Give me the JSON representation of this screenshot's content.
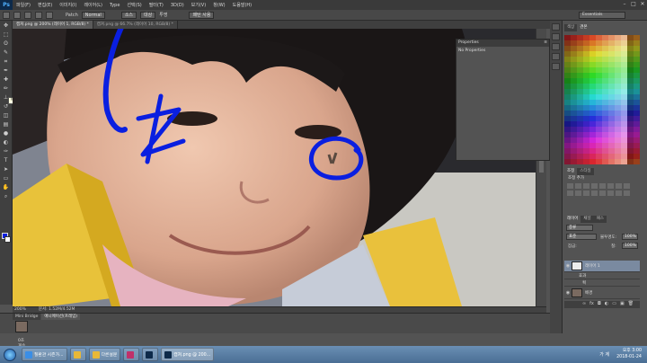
{
  "menubar": {
    "logo": "Ps",
    "items": [
      "파일(F)",
      "편집(E)",
      "이미지(I)",
      "레이어(L)",
      "Type",
      "선택(S)",
      "필터(T)",
      "3D(D)",
      "보기(V)",
      "창(W)",
      "도움말(H)"
    ]
  },
  "options": {
    "patch_label": "Patch",
    "mode_value": "Normal",
    "source_label": "소스",
    "dest_label": "대상",
    "transparent_label": "투명",
    "use_pattern_label": "패턴 사용"
  },
  "workspace": {
    "value": "Essentials"
  },
  "doc_tabs": [
    {
      "label": "캡쳐.png @ 200% (레이어 1, RGB/8) *"
    },
    {
      "label": "캡쳐.png @ 66.7% (레이어 10, RGB/8) *"
    }
  ],
  "tooltip": {
    "text": "패치 도구 (J)"
  },
  "status": {
    "zoom": "200%",
    "doc": "문서: 1.52M/4.52M"
  },
  "properties": {
    "title": "Properties",
    "body": "No Properties"
  },
  "panels": {
    "color_tabs": [
      "색상",
      "견본"
    ],
    "adjust_tabs": [
      "조정",
      "스타일"
    ],
    "adjust_title": "조정 추가",
    "layer_tabs": [
      "레이어",
      "채널",
      "패스"
    ],
    "kind_label": "종류",
    "blend_value": "표준",
    "opacity_label": "불투명도:",
    "opacity_value": "100%",
    "lock_label": "잠금:",
    "fill_label": "칠:",
    "fill_value": "100%",
    "layers": [
      {
        "name": "레이어 1",
        "selected": true
      },
      {
        "name": "효과"
      },
      {
        "name": "획"
      },
      {
        "name": "배경"
      }
    ]
  },
  "lower": {
    "tabs": [
      "Mini Bridge",
      "애니메이션(프레임)"
    ],
    "frame_time": "0초",
    "note": "계속"
  },
  "taskbar": {
    "buttons": [
      {
        "label": "질환관 시즌가..."
      },
      {
        "label": ""
      },
      {
        "label": "다른설문"
      },
      {
        "label": ""
      },
      {
        "label": ""
      },
      {
        "label": "캡쳐.png @ 200..."
      }
    ],
    "lang": "가 계",
    "time": "오후 3:00",
    "date": "2018-01-24"
  },
  "colors": {
    "drawing_blue": "#0a1fe0",
    "menu_bg": "#3a3a3a",
    "panel_bg": "#535353"
  }
}
